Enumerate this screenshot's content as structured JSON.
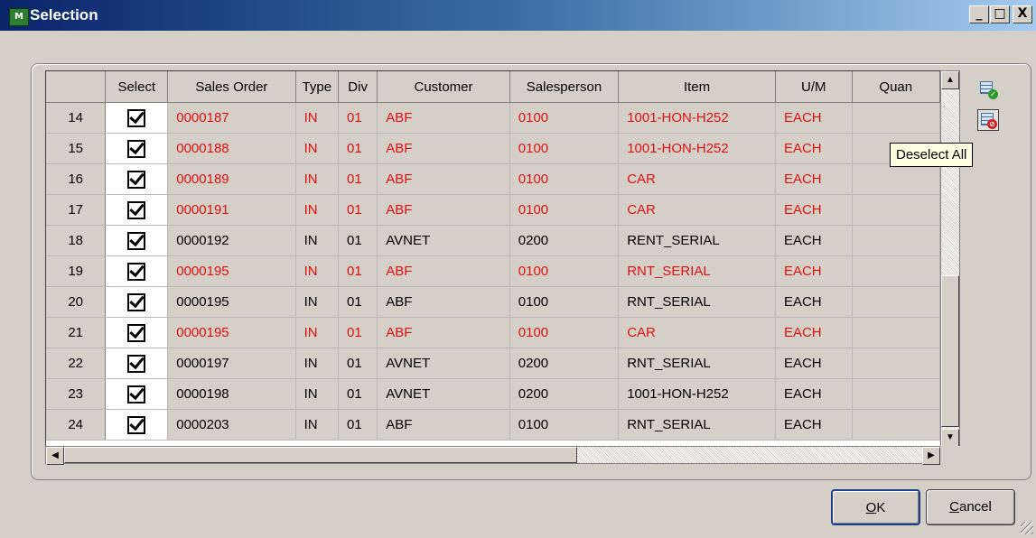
{
  "window": {
    "title": "Selection",
    "icon": "app-icon",
    "controls": {
      "minimize": "_",
      "maximize": "□",
      "close": "X"
    }
  },
  "grid": {
    "columns": [
      "",
      "Select",
      "Sales Order",
      "Type",
      "Div",
      "Customer",
      "Salesperson",
      "Item",
      "U/M",
      "Quan"
    ],
    "rows": [
      {
        "n": "14",
        "order": "0000187",
        "type": "IN",
        "div": "01",
        "customer": "ABF",
        "salesperson": "0100",
        "item": "1001-HON-H252",
        "um": "EACH",
        "qty": "",
        "red": true
      },
      {
        "n": "15",
        "order": "0000188",
        "type": "IN",
        "div": "01",
        "customer": "ABF",
        "salesperson": "0100",
        "item": "1001-HON-H252",
        "um": "EACH",
        "qty": "",
        "red": true
      },
      {
        "n": "16",
        "order": "0000189",
        "type": "IN",
        "div": "01",
        "customer": "ABF",
        "salesperson": "0100",
        "item": "CAR",
        "um": "EACH",
        "qty": "",
        "red": true
      },
      {
        "n": "17",
        "order": "0000191",
        "type": "IN",
        "div": "01",
        "customer": "ABF",
        "salesperson": "0100",
        "item": "CAR",
        "um": "EACH",
        "qty": "",
        "red": true
      },
      {
        "n": "18",
        "order": "0000192",
        "type": "IN",
        "div": "01",
        "customer": "AVNET",
        "salesperson": "0200",
        "item": "RENT_SERIAL",
        "um": "EACH",
        "qty": "",
        "red": false
      },
      {
        "n": "19",
        "order": "0000195",
        "type": "IN",
        "div": "01",
        "customer": "ABF",
        "salesperson": "0100",
        "item": "RNT_SERIAL",
        "um": "EACH",
        "qty": "",
        "red": true
      },
      {
        "n": "20",
        "order": "0000195",
        "type": "IN",
        "div": "01",
        "customer": "ABF",
        "salesperson": "0100",
        "item": "RNT_SERIAL",
        "um": "EACH",
        "qty": "",
        "red": false
      },
      {
        "n": "21",
        "order": "0000195",
        "type": "IN",
        "div": "01",
        "customer": "ABF",
        "salesperson": "0100",
        "item": "CAR",
        "um": "EACH",
        "qty": "",
        "red": true
      },
      {
        "n": "22",
        "order": "0000197",
        "type": "IN",
        "div": "01",
        "customer": "AVNET",
        "salesperson": "0200",
        "item": "RNT_SERIAL",
        "um": "EACH",
        "qty": "",
        "red": false
      },
      {
        "n": "23",
        "order": "0000198",
        "type": "IN",
        "div": "01",
        "customer": "AVNET",
        "salesperson": "0200",
        "item": "1001-HON-H252",
        "um": "EACH",
        "qty": "",
        "red": false
      },
      {
        "n": "24",
        "order": "0000203",
        "type": "IN",
        "div": "01",
        "customer": "ABF",
        "salesperson": "0100",
        "item": "RNT_SERIAL",
        "um": "EACH",
        "qty": "",
        "red": false
      }
    ],
    "all_selected": true
  },
  "side_tools": {
    "select_all_icon": "select-all-icon",
    "deselect_all_icon": "deselect-all-icon"
  },
  "tooltip": {
    "text": "Deselect All"
  },
  "buttons": {
    "ok": "OK",
    "ok_mnemonic": "O",
    "cancel": "Cancel",
    "cancel_mnemonic": "C"
  },
  "colors": {
    "title_start": "#0a246a",
    "title_end": "#a6caf0",
    "highlight_row_text": "#e01010",
    "face": "#d4d0c8"
  }
}
